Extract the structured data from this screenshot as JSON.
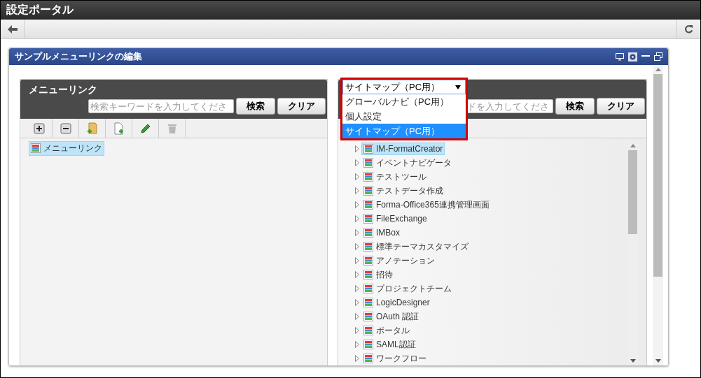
{
  "window": {
    "title": "設定ポータル"
  },
  "portlet": {
    "title": "サンプルメニューリンクの編集"
  },
  "left_panel": {
    "title": "メニューリンク",
    "search": {
      "placeholder": "検索キーワードを入力してくださ"
    },
    "buttons": [
      "検索",
      "クリア"
    ],
    "toolbar": [
      {
        "kind": "expand",
        "disabled": false
      },
      {
        "kind": "collapse",
        "disabled": false
      },
      {
        "kind": "add-folder",
        "disabled": false
      },
      {
        "kind": "add-item",
        "disabled": false
      },
      {
        "kind": "edit",
        "disabled": false
      },
      {
        "kind": "delete",
        "disabled": true
      }
    ],
    "tree": [
      {
        "label": "メニューリンク",
        "selected": true
      }
    ]
  },
  "right_panel": {
    "select": {
      "value": "サイトマップ（PC用）",
      "expanded": true,
      "options": [
        {
          "label": "グローバルナビ（PC用）",
          "selected": false
        },
        {
          "label": "個人設定",
          "selected": false
        },
        {
          "label": "サイトマップ（PC用）",
          "selected": true
        }
      ]
    },
    "search": {
      "placeholder": "ドを入力してくださ"
    },
    "buttons": [
      "検索",
      "クリア"
    ],
    "tree": [
      {
        "label": "IM-FormatCreator",
        "selected": true
      },
      {
        "label": "イベントナビゲータ",
        "selected": false
      },
      {
        "label": "テストツール",
        "selected": false
      },
      {
        "label": "テストデータ作成",
        "selected": false
      },
      {
        "label": "Forma-Office365連携管理画面",
        "selected": false
      },
      {
        "label": "FileExchange",
        "selected": false
      },
      {
        "label": "IMBox",
        "selected": false
      },
      {
        "label": "標準テーマカスタマイズ",
        "selected": false
      },
      {
        "label": "アノテーション",
        "selected": false
      },
      {
        "label": "招待",
        "selected": false
      },
      {
        "label": "プロジェクトチーム",
        "selected": false
      },
      {
        "label": "LogicDesigner",
        "selected": false
      },
      {
        "label": "OAuth 認証",
        "selected": false
      },
      {
        "label": "ポータル",
        "selected": false
      },
      {
        "label": "SAML認証",
        "selected": false
      },
      {
        "label": "ワークフロー",
        "selected": false
      }
    ]
  }
}
